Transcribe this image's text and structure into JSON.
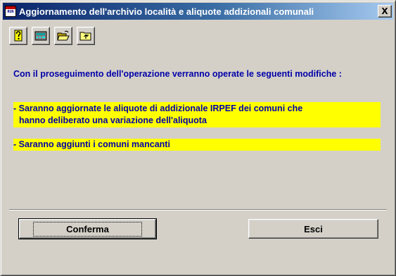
{
  "window": {
    "title": "Aggiornamento dell'archivio località e aliquote addizionali comunali",
    "app_icon_text": "RUN",
    "close_label": "X"
  },
  "toolbar": {
    "buttons": [
      {
        "icon": "help-icon"
      },
      {
        "icon": "calculator-icon"
      },
      {
        "icon": "open-folder-icon"
      },
      {
        "icon": "up-folder-icon"
      }
    ]
  },
  "content": {
    "intro": "Con il proseguimento dell'operazione verranno operate le seguenti modifiche :",
    "change1_line1": "- Saranno aggiornate le aliquote di addizionale IRPEF dei comuni che",
    "change1_line2": "hanno deliberato una variazione dell'aliquota",
    "change2": "- Saranno aggiunti i comuni mancanti"
  },
  "buttons": {
    "confirm_label": "Conferma",
    "exit_label": "Esci"
  },
  "colors": {
    "highlight": "#ffff00",
    "text": "#0000a8",
    "titlebar_start": "#0a246a",
    "titlebar_end": "#a6caf0",
    "face": "#d4d0c8"
  }
}
